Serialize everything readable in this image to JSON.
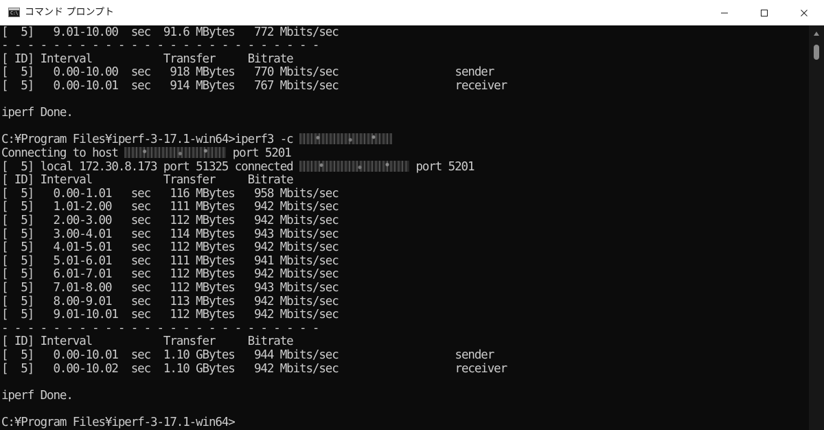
{
  "window": {
    "title": "コマンド プロンプト",
    "icon": "cmd-icon",
    "icon_text": "C:\\",
    "controls": [
      "minimize-icon",
      "maximize-icon",
      "close-icon"
    ]
  },
  "console": {
    "lines": [
      "[  5]   9.01-10.00  sec  91.6 MBytes   772 Mbits/sec",
      "- - - - - - - - - - - - - - - - - - - - - - - - -",
      "[ ID] Interval           Transfer     Bitrate",
      "[  5]   0.00-10.00  sec   918 MBytes   770 Mbits/sec                  sender",
      "[  5]   0.00-10.01  sec   914 MBytes   767 Mbits/sec                  receiver",
      "",
      "iperf Done.",
      "",
      "C:¥Program Files¥iperf-3-17.1-win64>iperf3 -c ",
      "Connecting to host ",
      "[  5] local 172.30.8.173 port 51325 connected ",
      "[ ID] Interval           Transfer     Bitrate",
      "[  5]   0.00-1.01   sec   116 MBytes   958 Mbits/sec",
      "[  5]   1.01-2.00   sec   111 MBytes   942 Mbits/sec",
      "[  5]   2.00-3.00   sec   112 MBytes   942 Mbits/sec",
      "[  5]   3.00-4.01   sec   114 MBytes   943 Mbits/sec",
      "[  5]   4.01-5.01   sec   112 MBytes   942 Mbits/sec",
      "[  5]   5.01-6.01   sec   111 MBytes   941 Mbits/sec",
      "[  5]   6.01-7.01   sec   112 MBytes   942 Mbits/sec",
      "[  5]   7.01-8.00   sec   112 MBytes   943 Mbits/sec",
      "[  5]   8.00-9.01   sec   113 MBytes   942 Mbits/sec",
      "[  5]   9.01-10.01  sec   112 MBytes   942 Mbits/sec",
      "- - - - - - - - - - - - - - - - - - - - - - - - -",
      "[ ID] Interval           Transfer     Bitrate",
      "[  5]   0.00-10.01  sec  1.10 GBytes   944 Mbits/sec                  sender",
      "[  5]   0.00-10.02  sec  1.10 GBytes   942 Mbits/sec                  receiver",
      "",
      "iperf Done.",
      "",
      "C:¥Program Files¥iperf-3-17.1-win64>"
    ],
    "redacted_suffix": {
      "8": " port 5201_after_host",
      "9": " port 5201",
      "10": " port 5201"
    }
  },
  "colors": {
    "console_bg": "#0c0c0c",
    "console_fg": "#cccccc",
    "titlebar_bg": "#ffffff"
  }
}
